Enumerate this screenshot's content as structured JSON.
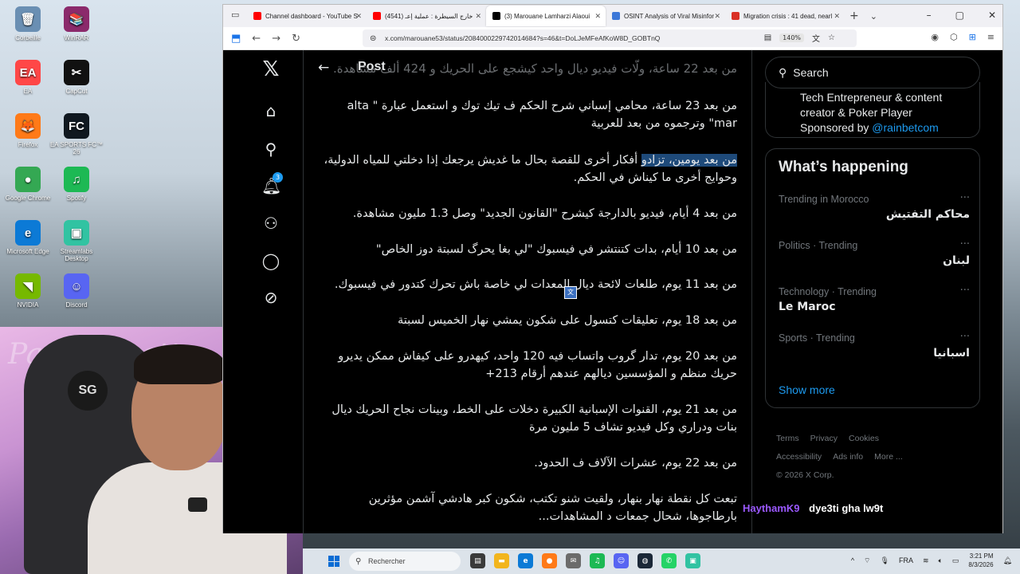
{
  "desktop": {
    "icons": [
      {
        "label": "Corbeille",
        "glyph": "🗑",
        "color": "#6a8fb3"
      },
      {
        "label": "WinRAR",
        "glyph": "📚",
        "color": "#8b2a6b"
      },
      {
        "label": "EA",
        "glyph": "EA",
        "color": "#ff4747"
      },
      {
        "label": "CapCut",
        "glyph": "✂",
        "color": "#111111"
      },
      {
        "label": "Firefox",
        "glyph": "🦊",
        "color": "#ff7a18"
      },
      {
        "label": "EA SPORTS FC™ 26",
        "glyph": "FC",
        "color": "#101820"
      },
      {
        "label": "Google Chrome",
        "glyph": "●",
        "color": "#34a853"
      },
      {
        "label": "Spotify",
        "glyph": "♫",
        "color": "#1db954"
      },
      {
        "label": "Microsoft Edge",
        "glyph": "e",
        "color": "#0c7ad6"
      },
      {
        "label": "Streamlabs Desktop",
        "glyph": "▣",
        "color": "#31c3a2"
      },
      {
        "label": "NVIDIA",
        "glyph": "◥",
        "color": "#76b900"
      },
      {
        "label": "Discord",
        "glyph": "☺",
        "color": "#5865f2"
      }
    ]
  },
  "webcam": {
    "neon_text": "Paul Sweett",
    "chair_logo": "SG"
  },
  "browser": {
    "tabs": [
      {
        "label": "Channel dashboard - YouTube S",
        "fav_color": "#ff0000",
        "active": false
      },
      {
        "label": "(4541) خارج السيطرة : عملية إعـ",
        "fav_color": "#ff0000",
        "active": false
      },
      {
        "label": "(3) Marouane Lamharzi Alaoui",
        "fav_color": "#000000",
        "active": true
      },
      {
        "label": "OSINT Analysis of Viral Misinfor",
        "fav_color": "#3c78d8",
        "active": false
      },
      {
        "label": "Migration crisis : 41 dead, nearl",
        "fav_color": "#d93025",
        "active": false
      }
    ],
    "url": "x.com/marouane53/status/2084000229742014684?s=46&t=DoLJeMFeAfKoW8D_GOBTnQ",
    "zoom": "140%"
  },
  "x": {
    "header_title": "Post",
    "header_faded": "من بعد 22 ساعة، ولّات فيديو ديال واحد كيشجع على الحريك و 424 ألف مشاهدة.",
    "paragraphs": [
      "من بعد 23 ساعة، محامي إسباني شرح الحكم ف تيك توك و استعمل عبارة \" alta mar\" وترجموه من بعد للعربية",
      "من بعد يومين، تزادو أفكار أخرى للقصة بحال ما غديش يرجعك إذا دخلتي للمياه الدولية، وحوايج أخرى ما كيناش في الحكم.",
      "من بعد 4 أيام، فيديو بالدارجة كيشرح \"القانون الجديد\" وصل 1.3 مليون مشاهدة.",
      "من بعد 10 أيام، بدات كتنتشر في فيسبوك \"لي بغا يحرگ لسبتة دوز الخاص\"",
      "من بعد 11 يوم، طلعات لائحة ديال المعدات لي خاصة باش تحرك كتدور في فيسبوك.",
      "من بعد 18 يوم، تعليقات كتسول على شكون يمشي نهار الخميس لسبتة",
      "من بعد 20 يوم، تدار گروب واتساب فيه 120 واحد، كيهدرو على كيفاش ممكن يديرو حريك منظم و المؤسسين ديالهم عندهم أرقام 213+",
      "من بعد 21 يوم، القنوات الإسبانية الكبيرة دخلات على الخط، وبينات نجاح الحريك ديال بنات ودراري وكل فيديو تشاف 5 مليون مرة",
      "من بعد 22 يوم، عشرات الآلاف ف الحدود.",
      "تبعت كل نقطة نهار بنهار، ولقيت شنو تكتب، شكون كبر هادشي آشمن مؤثرين بارطاجوها، شحال جمعات د المشاهدات..."
    ],
    "search_placeholder": "Search",
    "ad": {
      "line1": "Tech Entrepreneur & content creator & Poker Player",
      "sponsored": "Sponsored by",
      "sponsor": "@rainbetcom"
    },
    "whats_happening": "What’s happening",
    "trends": [
      {
        "meta": "Trending in Morocco",
        "name": "محاكم التفتيش",
        "rtl": true
      },
      {
        "meta": "Politics · Trending",
        "name": "لبنان",
        "rtl": true
      },
      {
        "meta": "Technology · Trending",
        "name": "Le Maroc",
        "rtl": false
      },
      {
        "meta": "Sports · Trending",
        "name": "اسبانيا",
        "rtl": true
      }
    ],
    "show_more": "Show more",
    "footer": [
      "Terms",
      "Privacy",
      "Cookies",
      "Accessibility",
      "Ads info",
      "More ...",
      "© 2026 X Corp."
    ],
    "notification_count": "3"
  },
  "chat": {
    "user": "HaythamK9",
    "message": "dye3ti gha lw9t"
  },
  "taskbar": {
    "search": "Rechercher",
    "apps": [
      {
        "glyph": "▤",
        "color": "#3a3a3a"
      },
      {
        "glyph": "▬",
        "color": "#f2b51d"
      },
      {
        "glyph": "e",
        "color": "#0c7ad6"
      },
      {
        "glyph": "●",
        "color": "#ff7a18"
      },
      {
        "glyph": "✉",
        "color": "#6b6b6b"
      },
      {
        "glyph": "♫",
        "color": "#1db954"
      },
      {
        "glyph": "☺",
        "color": "#5865f2"
      },
      {
        "glyph": "◍",
        "color": "#1b2838"
      },
      {
        "glyph": "✆",
        "color": "#25d366"
      },
      {
        "glyph": "▣",
        "color": "#31c3a2"
      }
    ],
    "lang": "FRA",
    "time": "3:21 PM",
    "date": "8/3/2026"
  }
}
